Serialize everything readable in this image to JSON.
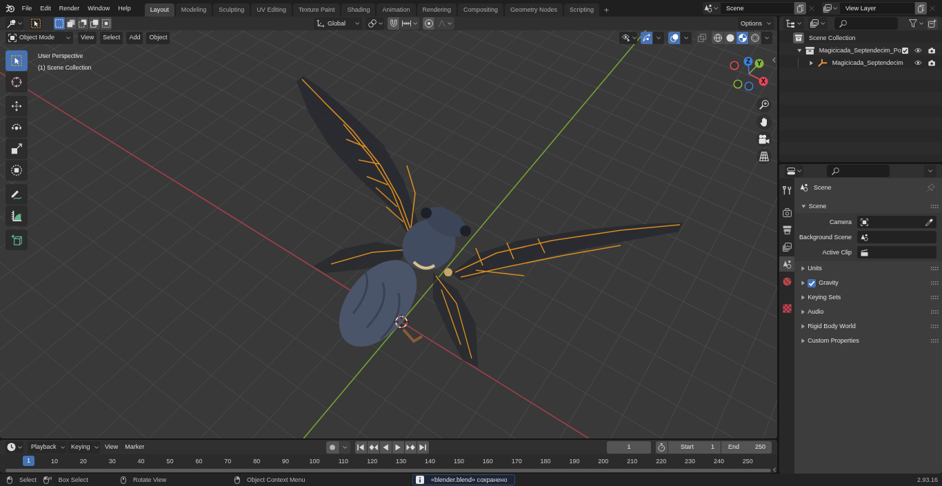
{
  "topbar": {
    "menus": [
      "File",
      "Edit",
      "Render",
      "Window",
      "Help"
    ],
    "workspaces": [
      {
        "label": "Layout",
        "selected": true
      },
      {
        "label": "Modeling",
        "selected": false
      },
      {
        "label": "Sculpting",
        "selected": false
      },
      {
        "label": "UV Editing",
        "selected": false
      },
      {
        "label": "Texture Paint",
        "selected": false
      },
      {
        "label": "Shading",
        "selected": false
      },
      {
        "label": "Animation",
        "selected": false
      },
      {
        "label": "Rendering",
        "selected": false
      },
      {
        "label": "Compositing",
        "selected": false
      },
      {
        "label": "Geometry Nodes",
        "selected": false
      },
      {
        "label": "Scripting",
        "selected": false
      }
    ],
    "add_workspace": "+",
    "scene": "Scene",
    "view_layer": "View Layer"
  },
  "viewport": {
    "header": {
      "select_modes": [
        {
          "kind": "new",
          "selected": true
        },
        {
          "kind": "extend",
          "selected": false
        },
        {
          "kind": "subtract",
          "selected": false
        },
        {
          "kind": "invert",
          "selected": false
        },
        {
          "kind": "intersect",
          "selected": false
        }
      ],
      "orientation": "Global",
      "options": "Options",
      "mode": "Object Mode",
      "menus": [
        "View",
        "Select",
        "Add",
        "Object"
      ],
      "gizmos": {
        "on": true
      },
      "overlays": {
        "on": true
      },
      "xray": {
        "on": false
      },
      "shading_modes": [
        {
          "kind": "wireframe",
          "selected": false
        },
        {
          "kind": "solid",
          "selected": false
        },
        {
          "kind": "material",
          "selected": true
        },
        {
          "kind": "rendered",
          "selected": false
        }
      ]
    },
    "info": [
      "User Perspective",
      "(1) Scene Collection"
    ],
    "tool_groups": [
      {
        "tools": [
          {
            "kind": "select",
            "selected": true
          },
          {
            "kind": "cursor",
            "selected": false
          }
        ]
      },
      {
        "tools": [
          {
            "kind": "move",
            "selected": false
          },
          {
            "kind": "rotate",
            "selected": false
          },
          {
            "kind": "scale",
            "selected": false
          },
          {
            "kind": "transform",
            "selected": false
          }
        ]
      },
      {
        "tools": [
          {
            "kind": "annotate",
            "selected": false
          },
          {
            "kind": "measure",
            "selected": false
          }
        ]
      },
      {
        "tools": [
          {
            "kind": "add",
            "selected": false
          }
        ]
      }
    ],
    "nav_gizmo": [
      {
        "kind": "positive",
        "label": "X",
        "color": "#e8475a"
      },
      {
        "kind": "positive",
        "label": "Y",
        "color": "#86b43a"
      },
      {
        "kind": "positive",
        "label": "Z",
        "color": "#3c80dc"
      },
      {
        "kind": "negative",
        "color": "#e8475a"
      },
      {
        "kind": "negative",
        "color": "#86b43a"
      },
      {
        "kind": "negative",
        "color": "#3c80dc"
      }
    ]
  },
  "outliner": {
    "tree": [
      {
        "label": "Scene Collection",
        "kind": "scene-collection",
        "children": [
          {
            "label": "Magicicada_Septendecim_Po",
            "kind": "collection",
            "expanded": true,
            "checked": true,
            "visible": true,
            "renderable": true,
            "children": [
              {
                "label": "Magicicada_Septendecim",
                "kind": "armature",
                "expanded": false,
                "visible": true,
                "renderable": true
              }
            ]
          }
        ]
      }
    ]
  },
  "properties": {
    "tab_groups": [
      {
        "tabs": [
          {
            "kind": "tool",
            "selected": false
          }
        ]
      },
      {
        "tabs": [
          {
            "kind": "render",
            "selected": false
          },
          {
            "kind": "output",
            "selected": false
          },
          {
            "kind": "view-layer",
            "selected": false
          },
          {
            "kind": "scene",
            "selected": true
          },
          {
            "kind": "world",
            "selected": false
          }
        ]
      },
      {
        "tabs": [
          {
            "kind": "texture",
            "selected": false
          }
        ]
      }
    ],
    "context": "Scene",
    "panels": [
      {
        "title": "Scene",
        "expanded": true,
        "fields": [
          {
            "label": "Camera",
            "kind": "camera"
          },
          {
            "label": "Background Scene",
            "kind": "scene"
          },
          {
            "label": "Active Clip",
            "kind": "clip"
          }
        ]
      },
      {
        "title": "Units",
        "expanded": false
      },
      {
        "title": "Gravity",
        "expanded": false,
        "checked": true
      },
      {
        "title": "Keying Sets",
        "expanded": false
      },
      {
        "title": "Audio",
        "expanded": false
      },
      {
        "title": "Rigid Body World",
        "expanded": false
      },
      {
        "title": "Custom Properties",
        "expanded": false
      }
    ]
  },
  "timeline": {
    "menus": [
      {
        "label": "Playback",
        "kind": "dropdown"
      },
      {
        "label": "Keying",
        "kind": "dropdown"
      },
      {
        "label": "View",
        "kind": "menu"
      },
      {
        "label": "Marker",
        "kind": "menu"
      }
    ],
    "auto_keying": {
      "on": false
    },
    "current_frame": "1",
    "start_label": "Start",
    "start": "1",
    "end_label": "End",
    "end": "250",
    "playhead": "1",
    "frames": [
      "10",
      "20",
      "30",
      "40",
      "50",
      "60",
      "70",
      "80",
      "90",
      "100",
      "110",
      "120",
      "130",
      "140",
      "150",
      "160",
      "170",
      "180",
      "190",
      "200",
      "210",
      "220",
      "230",
      "240",
      "250"
    ]
  },
  "status_bar": {
    "hints": [
      {
        "kind": "mouse-left",
        "label": "Select"
      },
      {
        "kind": "box-drag",
        "label": "Box Select"
      },
      {
        "kind": "mouse-middle",
        "label": "Rotate View"
      },
      {
        "kind": "mouse-right",
        "label": "Object Context Menu"
      }
    ],
    "report": "«blender.blend» сохранено",
    "version": "2.93.16"
  }
}
